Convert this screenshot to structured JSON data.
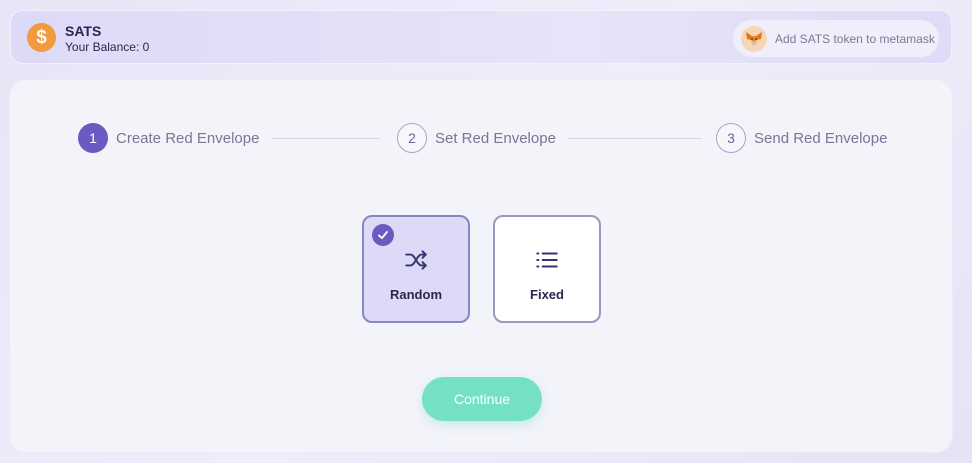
{
  "header": {
    "token_symbol": "$",
    "token_name": "SATS",
    "balance_label": "Your Balance: 0",
    "metamask_button": "Add SATS token to metamask"
  },
  "steps": [
    {
      "number": "1",
      "label": "Create Red Envelope",
      "active": true
    },
    {
      "number": "2",
      "label": "Set Red Envelope",
      "active": false
    },
    {
      "number": "3",
      "label": "Send Red Envelope",
      "active": false
    }
  ],
  "options": [
    {
      "label": "Random",
      "icon": "shuffle-icon",
      "selected": true
    },
    {
      "label": "Fixed",
      "icon": "list-icon",
      "selected": false
    }
  ],
  "continue_label": "Continue",
  "colors": {
    "accent": "#6a5bc3",
    "continue": "#74e0c6",
    "token": "#f29a3e"
  }
}
